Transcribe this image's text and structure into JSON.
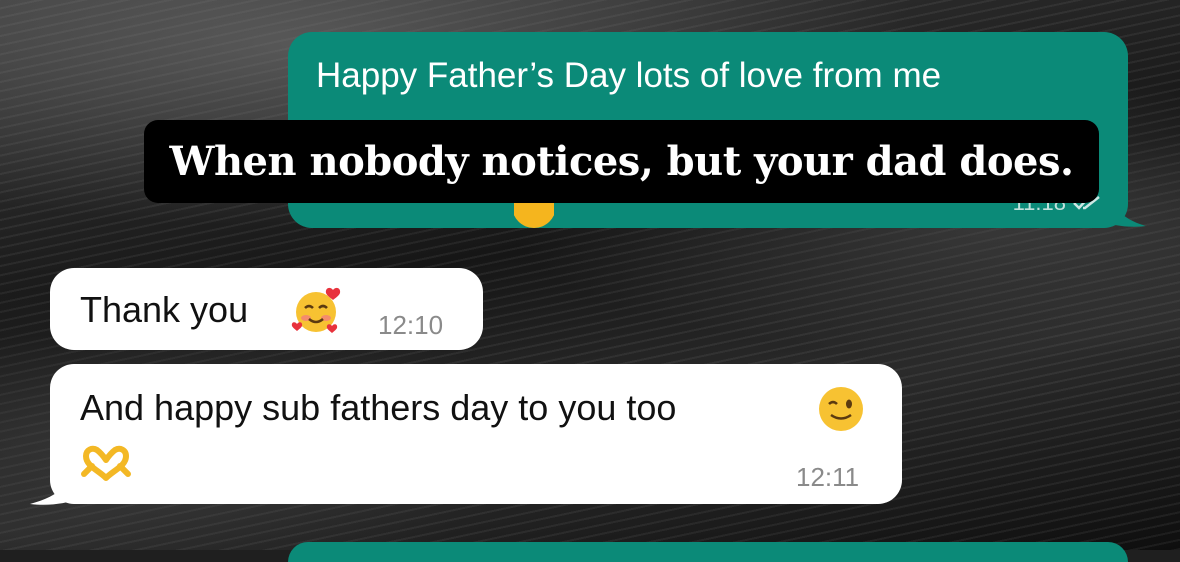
{
  "caption": "When nobody notices, but your dad does.",
  "messages": [
    {
      "direction": "outgoing",
      "text_line1": "Happy Father’s Day lots of love from me",
      "time": "11:18",
      "status": "read-double-tick-icon"
    },
    {
      "direction": "incoming",
      "text": "Thank you",
      "emoji": "smiling-face-with-hearts-icon",
      "time": "12:10"
    },
    {
      "direction": "incoming",
      "text": "And happy sub fathers day to you too",
      "emoji_inline": "winking-face-icon",
      "emoji_line2": "heart-hands-icon",
      "time": "12:11"
    }
  ],
  "colors": {
    "outgoing_bubble": "#0b8a78",
    "incoming_bubble": "#ffffff",
    "caption_background": "#000000"
  }
}
